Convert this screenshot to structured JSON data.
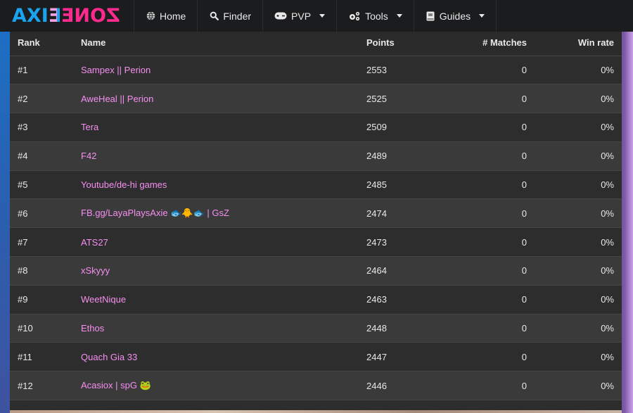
{
  "navbar": {
    "logo": {
      "part1": "AXI",
      "part2": "E",
      "part3": "ZONE"
    },
    "items": [
      {
        "label": "Home",
        "icon": "globe-icon",
        "dropdown": false
      },
      {
        "label": "Finder",
        "icon": "search-icon",
        "dropdown": false
      },
      {
        "label": "PVP",
        "icon": "gamepad-icon",
        "dropdown": true
      },
      {
        "label": "Tools",
        "icon": "cogs-icon",
        "dropdown": true
      },
      {
        "label": "Guides",
        "icon": "book-icon",
        "dropdown": true
      }
    ]
  },
  "colors": {
    "logo_blue": "#1aa3f0",
    "logo_pink": "#ff2a8e",
    "name_link": "#f58ff0",
    "navbar_bg": "#1b1c1e"
  },
  "table": {
    "headers": {
      "rank": "Rank",
      "name": "Name",
      "points": "Points",
      "matches": "# Matches",
      "win_rate": "Win rate"
    },
    "rows": [
      {
        "rank": "#1",
        "name": "Sampex || Perion",
        "points": "2553",
        "matches": "0",
        "win_rate": "0%"
      },
      {
        "rank": "#2",
        "name": "AweHeal || Perion",
        "points": "2525",
        "matches": "0",
        "win_rate": "0%"
      },
      {
        "rank": "#3",
        "name": "Tera",
        "points": "2509",
        "matches": "0",
        "win_rate": "0%"
      },
      {
        "rank": "#4",
        "name": "F42",
        "points": "2489",
        "matches": "0",
        "win_rate": "0%"
      },
      {
        "rank": "#5",
        "name": "Youtube/de-hi games",
        "points": "2485",
        "matches": "0",
        "win_rate": "0%"
      },
      {
        "rank": "#6",
        "name": "FB.gg/LayaPlaysAxie 🐟🐥🐟 | GsZ",
        "points": "2474",
        "matches": "0",
        "win_rate": "0%"
      },
      {
        "rank": "#7",
        "name": "ATS27",
        "points": "2473",
        "matches": "0",
        "win_rate": "0%"
      },
      {
        "rank": "#8",
        "name": "xSkyyy",
        "points": "2464",
        "matches": "0",
        "win_rate": "0%"
      },
      {
        "rank": "#9",
        "name": "WeetNique",
        "points": "2463",
        "matches": "0",
        "win_rate": "0%"
      },
      {
        "rank": "#10",
        "name": "Ethos",
        "points": "2448",
        "matches": "0",
        "win_rate": "0%"
      },
      {
        "rank": "#11",
        "name": "Quach Gia 33",
        "points": "2447",
        "matches": "0",
        "win_rate": "0%"
      },
      {
        "rank": "#12",
        "name": "Acasiox | spG 🐸",
        "points": "2446",
        "matches": "0",
        "win_rate": "0%"
      }
    ]
  }
}
